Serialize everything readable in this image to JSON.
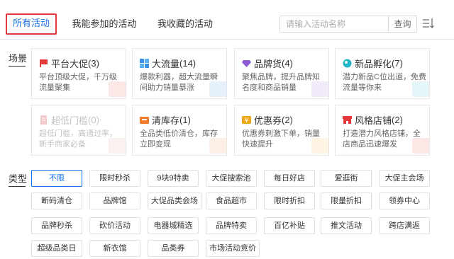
{
  "tabs": [
    {
      "label": "所有活动",
      "active": true
    },
    {
      "label": "我能参加的活动",
      "active": false
    },
    {
      "label": "我收藏的活动",
      "active": false
    }
  ],
  "search": {
    "placeholder": "请输入活动名称",
    "button": "查询"
  },
  "scene_label": "场景",
  "type_label": "类型",
  "scenes": [
    {
      "title": "平台大促",
      "count": "(3)",
      "desc": "平台顶级大促，千万级流量聚集",
      "icon": "flag-icon",
      "color": "#e4393c",
      "enabled": true
    },
    {
      "title": "大流量",
      "count": "(14)",
      "desc": "爆款利器，超大流量瞬间助力销量暴涨",
      "icon": "grid-icon",
      "color": "#3a8ee6",
      "enabled": true
    },
    {
      "title": "品牌货",
      "count": "(4)",
      "desc": "聚焦品牌，提升品牌知名度和商品销量",
      "icon": "diamond-icon",
      "color": "#8e5bd6",
      "enabled": true
    },
    {
      "title": "新品孵化",
      "count": "(7)",
      "desc": "潜力新品C位出道，免费流量等你来",
      "icon": "bubble-icon",
      "color": "#21b5c4",
      "enabled": true
    },
    {
      "title": "超低门槛",
      "count": "(0)",
      "desc": "超低门槛，高通过率，新手商家必备",
      "icon": "doc-icon",
      "color": "#e88a8a",
      "enabled": false
    },
    {
      "title": "清库存",
      "count": "(1)",
      "desc": "全品类低价清仓，库存立即变现",
      "icon": "box-icon",
      "color": "#f07c2e",
      "enabled": true
    },
    {
      "title": "优惠券",
      "count": "(2)",
      "desc": "优惠券刺激下单，销量快速提升",
      "icon": "coupon-icon",
      "color": "#f0a81a",
      "enabled": true
    },
    {
      "title": "风格店铺",
      "count": "(2)",
      "desc": "打造潜力风格店铺，全店商品迅速爆发",
      "icon": "shop-icon",
      "color": "#e4393c",
      "enabled": true
    }
  ],
  "types": [
    [
      "不限",
      "限时秒杀",
      "9块9特卖",
      "大促搜索池",
      "每日好店",
      "爱逛街",
      "大促主会场"
    ],
    [
      "断码清仓",
      "品牌馆",
      "大促品类会场",
      "食品超市",
      "限时折扣",
      "限量折扣",
      "领券中心"
    ],
    [
      "品牌秒杀",
      "砍价活动",
      "电器城精选",
      "品牌特卖",
      "百亿补贴",
      "推文活动",
      "跨店满返"
    ],
    [
      "超级品类日",
      "新衣馆",
      "品类券",
      "市场活动竞价"
    ]
  ],
  "active_type": "不限"
}
